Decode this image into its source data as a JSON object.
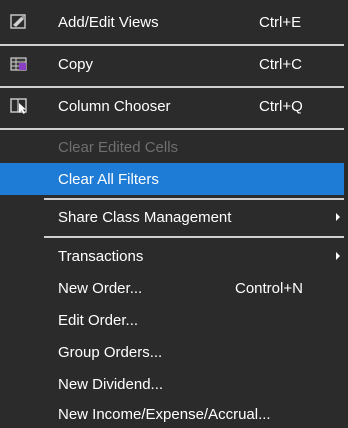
{
  "menu": {
    "items": [
      {
        "label": "Add/Edit Views",
        "shortcut": "Ctrl+E",
        "icon": "views-icon"
      },
      {
        "label": "Copy",
        "shortcut": "Ctrl+C",
        "icon": "copy-icon"
      },
      {
        "label": "Column Chooser",
        "shortcut": "Ctrl+Q",
        "icon": "column-chooser-icon"
      },
      {
        "label": "Clear Edited Cells",
        "state": "disabled"
      },
      {
        "label": "Clear All Filters",
        "state": "selected"
      },
      {
        "label": "Share Class Management",
        "submenu": true
      },
      {
        "label": "Transactions",
        "submenu": true
      },
      {
        "label": "New Order...",
        "shortcut": "Control+N"
      },
      {
        "label": "Edit Order..."
      },
      {
        "label": "Group Orders..."
      },
      {
        "label": "New Dividend..."
      },
      {
        "label": "New Income/Expense/Accrual..."
      }
    ]
  },
  "colors": {
    "background": "#2b2b2b",
    "selected": "#1e7bd6",
    "text": "#ffffff",
    "disabled_text": "#6f6f6f",
    "separator": "#cfcfcf"
  }
}
